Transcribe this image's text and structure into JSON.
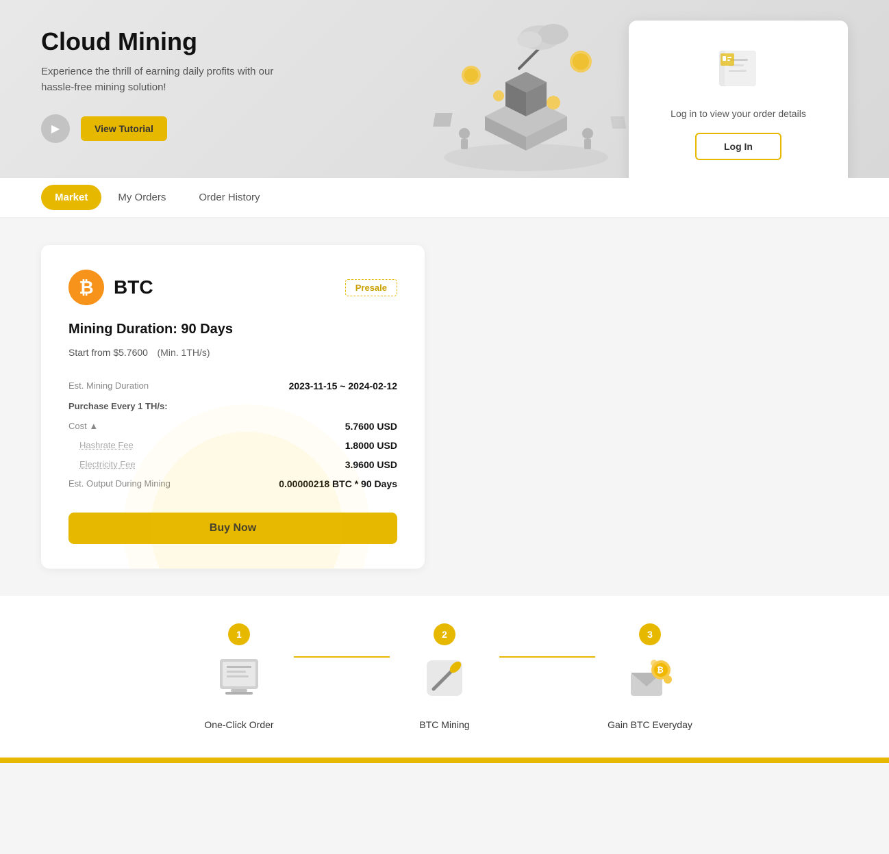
{
  "hero": {
    "title": "Cloud Mining",
    "subtitle": "Experience the thrill of earning daily profits with our hassle-free mining solution!",
    "play_label": "▶",
    "tutorial_label": "View Tutorial"
  },
  "login_card": {
    "text": "Log in to view your order details",
    "button_label": "Log In"
  },
  "tabs": [
    {
      "id": "market",
      "label": "Market",
      "active": true
    },
    {
      "id": "my-orders",
      "label": "My Orders",
      "active": false
    },
    {
      "id": "order-history",
      "label": "Order History",
      "active": false
    }
  ],
  "mining_card": {
    "coin": "BTC",
    "presale_label": "Presale",
    "duration_label": "Mining Duration: 90 Days",
    "start_from_label": "Start from $5.7600",
    "min_label": "(Min. 1TH/s)",
    "details": {
      "est_mining_label": "Est. Mining Duration",
      "est_mining_value": "2023-11-15 ~ 2024-02-12",
      "purchase_label": "Purchase Every 1 TH/s:",
      "cost_label": "Cost ▲",
      "cost_value": "5.7600 USD",
      "hashrate_label": "Hashrate Fee",
      "hashrate_value": "1.8000 USD",
      "electricity_label": "Electricity Fee",
      "electricity_value": "3.9600 USD",
      "output_label": "Est. Output During Mining",
      "output_value": "0.00000218 BTC * 90 Days"
    },
    "buy_label": "Buy Now"
  },
  "steps": [
    {
      "num": "1",
      "label": "One-Click Order",
      "icon": "🖥️"
    },
    {
      "num": "2",
      "label": "BTC Mining",
      "icon": "⛏️"
    },
    {
      "num": "3",
      "label": "Gain BTC Everyday",
      "icon": "💰"
    }
  ]
}
